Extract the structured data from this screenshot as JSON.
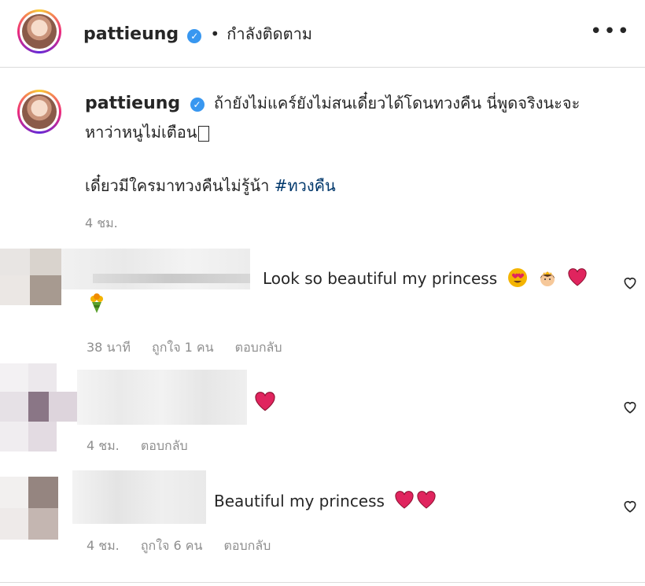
{
  "header": {
    "username": "pattieung",
    "separator": "•",
    "follow_status": "กำลังติดตาม",
    "more_icon": "more-horizontal-icon"
  },
  "post": {
    "username": "pattieung",
    "caption_line1": "ถ้ายังไม่แคร์ยังไม่สนเดี๋ยวได้โดนทวงคืน นี่พูดจริงนะจะ",
    "caption_line2": "หาว่าหนูไม่เตือน",
    "caption_line3": "เดี๋ยวมีใครมาทวงคืนไม่รู้น้า",
    "hashtag": "#ทวงคืน",
    "time": "4 ชม."
  },
  "comments": [
    {
      "text": "Look so beautiful my princess",
      "time": "38 นาที",
      "likes": "ถูกใจ 1 คน",
      "reply": "ตอบกลับ"
    },
    {
      "text": "",
      "time": "4 ชม.",
      "reply": "ตอบกลับ"
    },
    {
      "text": "Beautiful my princess",
      "time": "4 ชม.",
      "likes": "ถูกใจ 6 คน",
      "reply": "ตอบกลับ"
    }
  ],
  "colors": {
    "verified": "#3897f0",
    "hashtag": "#00376b",
    "muted": "#8e8e8e",
    "heart": "#e0245e"
  }
}
